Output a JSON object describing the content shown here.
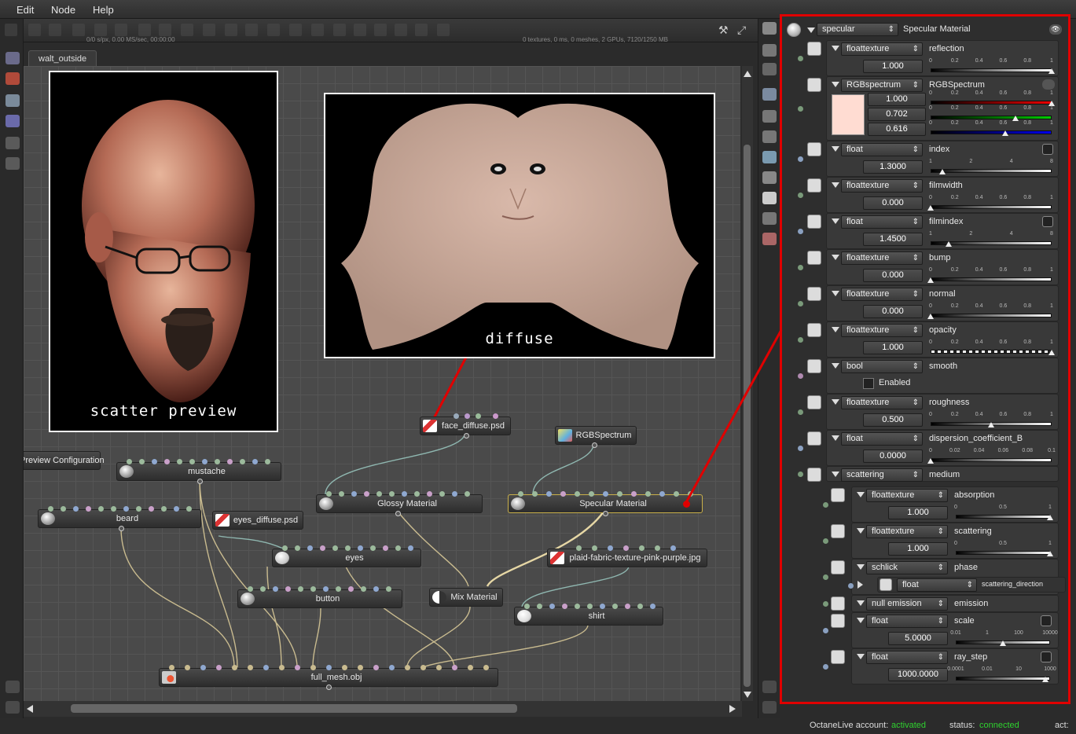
{
  "menu": [
    "Edit",
    "Node",
    "Help"
  ],
  "toolbar": {
    "stats_left": "0/0 s/px, 0.00 MS/sec, 00:00:00",
    "stats_right": "0 textures, 0 ms, 0 meshes, 2 GPUs, 7120/1250 MB"
  },
  "tab": "walt_outside",
  "previews": {
    "scatter": "scatter preview",
    "diffuse": "diffuse"
  },
  "nodes": {
    "face_diffuse": "face_diffuse.psd",
    "rgb": "RGBSpectrum",
    "preview_config": "Preview Configuration",
    "mustache": "mustache",
    "glossy": "Glossy Material",
    "specular": "Specular Material",
    "beard": "beard",
    "eyes_diffuse": "eyes_diffuse.psd",
    "eyes": "eyes",
    "plaid": "plaid-fabric-texture-pink-purple.jpg",
    "button": "button",
    "mix": "Mix Material",
    "shirt": "shirt",
    "full_mesh": "full_mesh.obj"
  },
  "panel": {
    "header": {
      "select": "specular",
      "title": "Specular Material"
    },
    "params": [
      {
        "type": "floattexture",
        "name": "reflection",
        "value": "1.000",
        "ticks": [
          "0",
          "0.2",
          "0.4",
          "0.6",
          "0.8",
          "1"
        ],
        "level": 1.0
      },
      {
        "type": "RGBspectrum",
        "name": "RGBSpectrum",
        "r": "1.000",
        "g": "0.702",
        "b": "0.616",
        "ticks": [
          "0",
          "0.2",
          "0.4",
          "0.6",
          "0.8",
          "1"
        ],
        "swatch": "#ffdcd2"
      },
      {
        "type": "float",
        "name": "index",
        "value": "1.3000",
        "ticks": [
          "1",
          "2",
          "4",
          "8"
        ],
        "level": 0.1
      },
      {
        "type": "floattexture",
        "name": "filmwidth",
        "value": "0.000",
        "ticks": [
          "0",
          "0.2",
          "0.4",
          "0.6",
          "0.8",
          "1"
        ],
        "level": 0.0
      },
      {
        "type": "float",
        "name": "filmindex",
        "value": "1.4500",
        "ticks": [
          "1",
          "2",
          "4",
          "8"
        ],
        "level": 0.15
      },
      {
        "type": "floattexture",
        "name": "bump",
        "value": "0.000",
        "ticks": [
          "0",
          "0.2",
          "0.4",
          "0.6",
          "0.8",
          "1"
        ],
        "level": 0.0
      },
      {
        "type": "floattexture",
        "name": "normal",
        "value": "0.000",
        "ticks": [
          "0",
          "0.2",
          "0.4",
          "0.6",
          "0.8",
          "1"
        ],
        "level": 0.0
      },
      {
        "type": "floattexture",
        "name": "opacity",
        "value": "1.000",
        "ticks": [
          "0",
          "0.2",
          "0.4",
          "0.6",
          "0.8",
          "1"
        ],
        "level": 1.0
      },
      {
        "type": "bool",
        "name": "smooth",
        "checkbox": "Enabled"
      },
      {
        "type": "floattexture",
        "name": "roughness",
        "value": "0.500",
        "ticks": [
          "0",
          "0.2",
          "0.4",
          "0.6",
          "0.8",
          "1"
        ],
        "level": 0.5
      },
      {
        "type": "float",
        "name": "dispersion_coefficient_B",
        "value": "0.0000",
        "ticks": [
          "0",
          "0.02",
          "0.04",
          "0.06",
          "0.08",
          "0.1"
        ],
        "level": 0.0
      },
      {
        "type": "scattering",
        "name": "medium"
      }
    ],
    "medium": [
      {
        "type": "floattexture",
        "name": "absorption",
        "value": "1.000",
        "ticks": [
          "0",
          "0.5",
          "1"
        ],
        "level": 1.0
      },
      {
        "type": "floattexture",
        "name": "scattering",
        "value": "1.000",
        "ticks": [
          "0",
          "0.5",
          "1"
        ],
        "level": 1.0
      },
      {
        "type": "schlick",
        "name": "phase",
        "sub_type": "float",
        "sub_name": "scattering_direction"
      },
      {
        "type": "null emission",
        "name": "emission"
      },
      {
        "type": "float",
        "name": "scale",
        "value": "5.0000",
        "ticks": [
          "0.01",
          "1",
          "100",
          "10000"
        ],
        "level": 0.5
      },
      {
        "type": "float",
        "name": "ray_step",
        "value": "1000.0000",
        "ticks": [
          "0.0001",
          "0.01",
          "10",
          "1000"
        ],
        "level": 0.95
      }
    ]
  },
  "status": {
    "account_label": "OctaneLive account:",
    "account_value": "activated",
    "status_label": "status:",
    "status_value": "connected",
    "act_label": "act:"
  },
  "colors": {
    "highlight": "#e00000",
    "status_ok": "#2fd12f"
  }
}
